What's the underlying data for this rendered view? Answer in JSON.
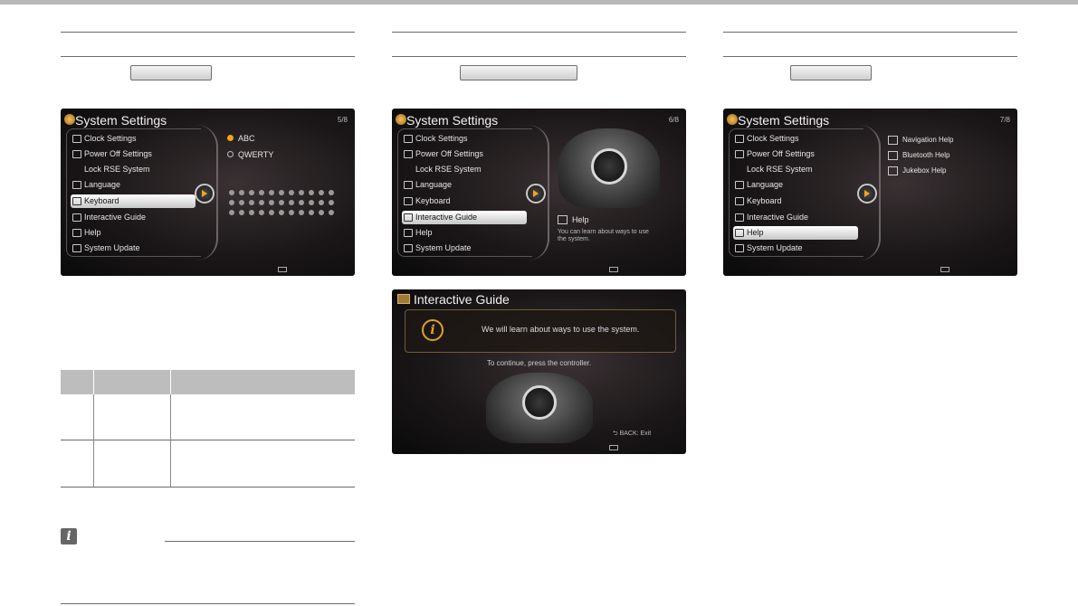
{
  "screens": {
    "keyboard": {
      "title": "System Settings",
      "page": "5/8",
      "menu": [
        "Clock Settings",
        "Power Off Settings",
        "Lock RSE System",
        "Language",
        "Keyboard",
        "Interactive Guide",
        "Help",
        "System Update"
      ],
      "options": [
        "ABC",
        "QWERTY"
      ]
    },
    "guide": {
      "title": "System Settings",
      "page": "6/8",
      "menu": [
        "Clock Settings",
        "Power Off Settings",
        "Lock RSE System",
        "Language",
        "Keyboard",
        "Interactive Guide",
        "Help",
        "System Update"
      ],
      "help_label": "Help",
      "help_desc": "You can learn about ways to use the system."
    },
    "help": {
      "title": "System Settings",
      "page": "7/8",
      "menu": [
        "Clock Settings",
        "Power Off Settings",
        "Lock RSE System",
        "Language",
        "Keyboard",
        "Interactive Guide",
        "Help",
        "System Update"
      ],
      "items": [
        "Navigation Help",
        "Bluetooth Help",
        "Jukebox Help"
      ]
    },
    "interactive_guide": {
      "title": "Interactive Guide",
      "message": "We will learn about ways to use the system.",
      "prompt": "To continue, press the controller.",
      "back": "BACK: Exit"
    }
  },
  "note_icon": "i",
  "icons": {
    "logo": "settings-logo-icon",
    "knob": "controller-knob-icon",
    "info": "info-icon"
  },
  "colors": {
    "accent": "#f0a420",
    "screen_bg": "#1b1718",
    "table_header": "#bdbdbd"
  }
}
